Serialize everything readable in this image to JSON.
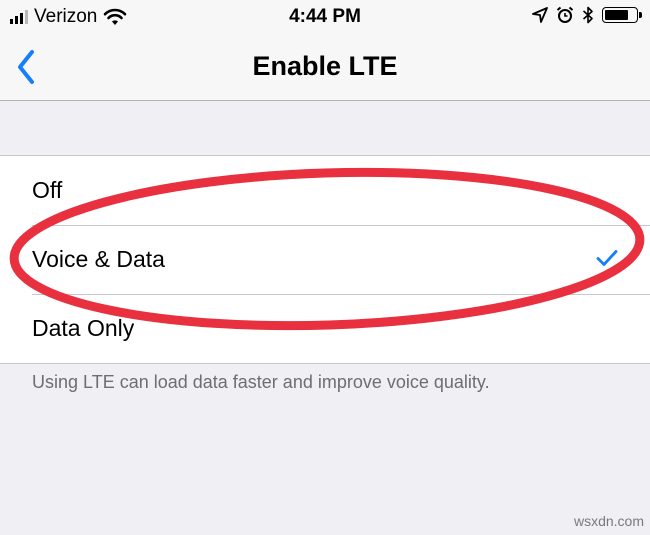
{
  "status_bar": {
    "carrier": "Verizon",
    "time": "4:44 PM",
    "signal_bars_filled": 3,
    "signal_bars_total": 4,
    "battery_level": 0.8,
    "icons": [
      "signal-icon",
      "wifi-icon",
      "location-icon",
      "alarm-icon",
      "bluetooth-icon",
      "battery-icon"
    ]
  },
  "nav": {
    "title": "Enable LTE",
    "back_icon": "chevron-left-icon"
  },
  "options": [
    {
      "label": "Off",
      "selected": false
    },
    {
      "label": "Voice & Data",
      "selected": true
    },
    {
      "label": "Data Only",
      "selected": false
    }
  ],
  "footer_note": "Using LTE can load data faster and improve voice quality.",
  "annotation": {
    "shape": "ellipse",
    "color": "#e8303f",
    "highlights": "Voice & Data"
  },
  "watermark": "wsxdn.com",
  "colors": {
    "accent": "#157efb",
    "background": "#efeff4",
    "separator": "#c8c7cc",
    "annotation": "#e8303f"
  }
}
